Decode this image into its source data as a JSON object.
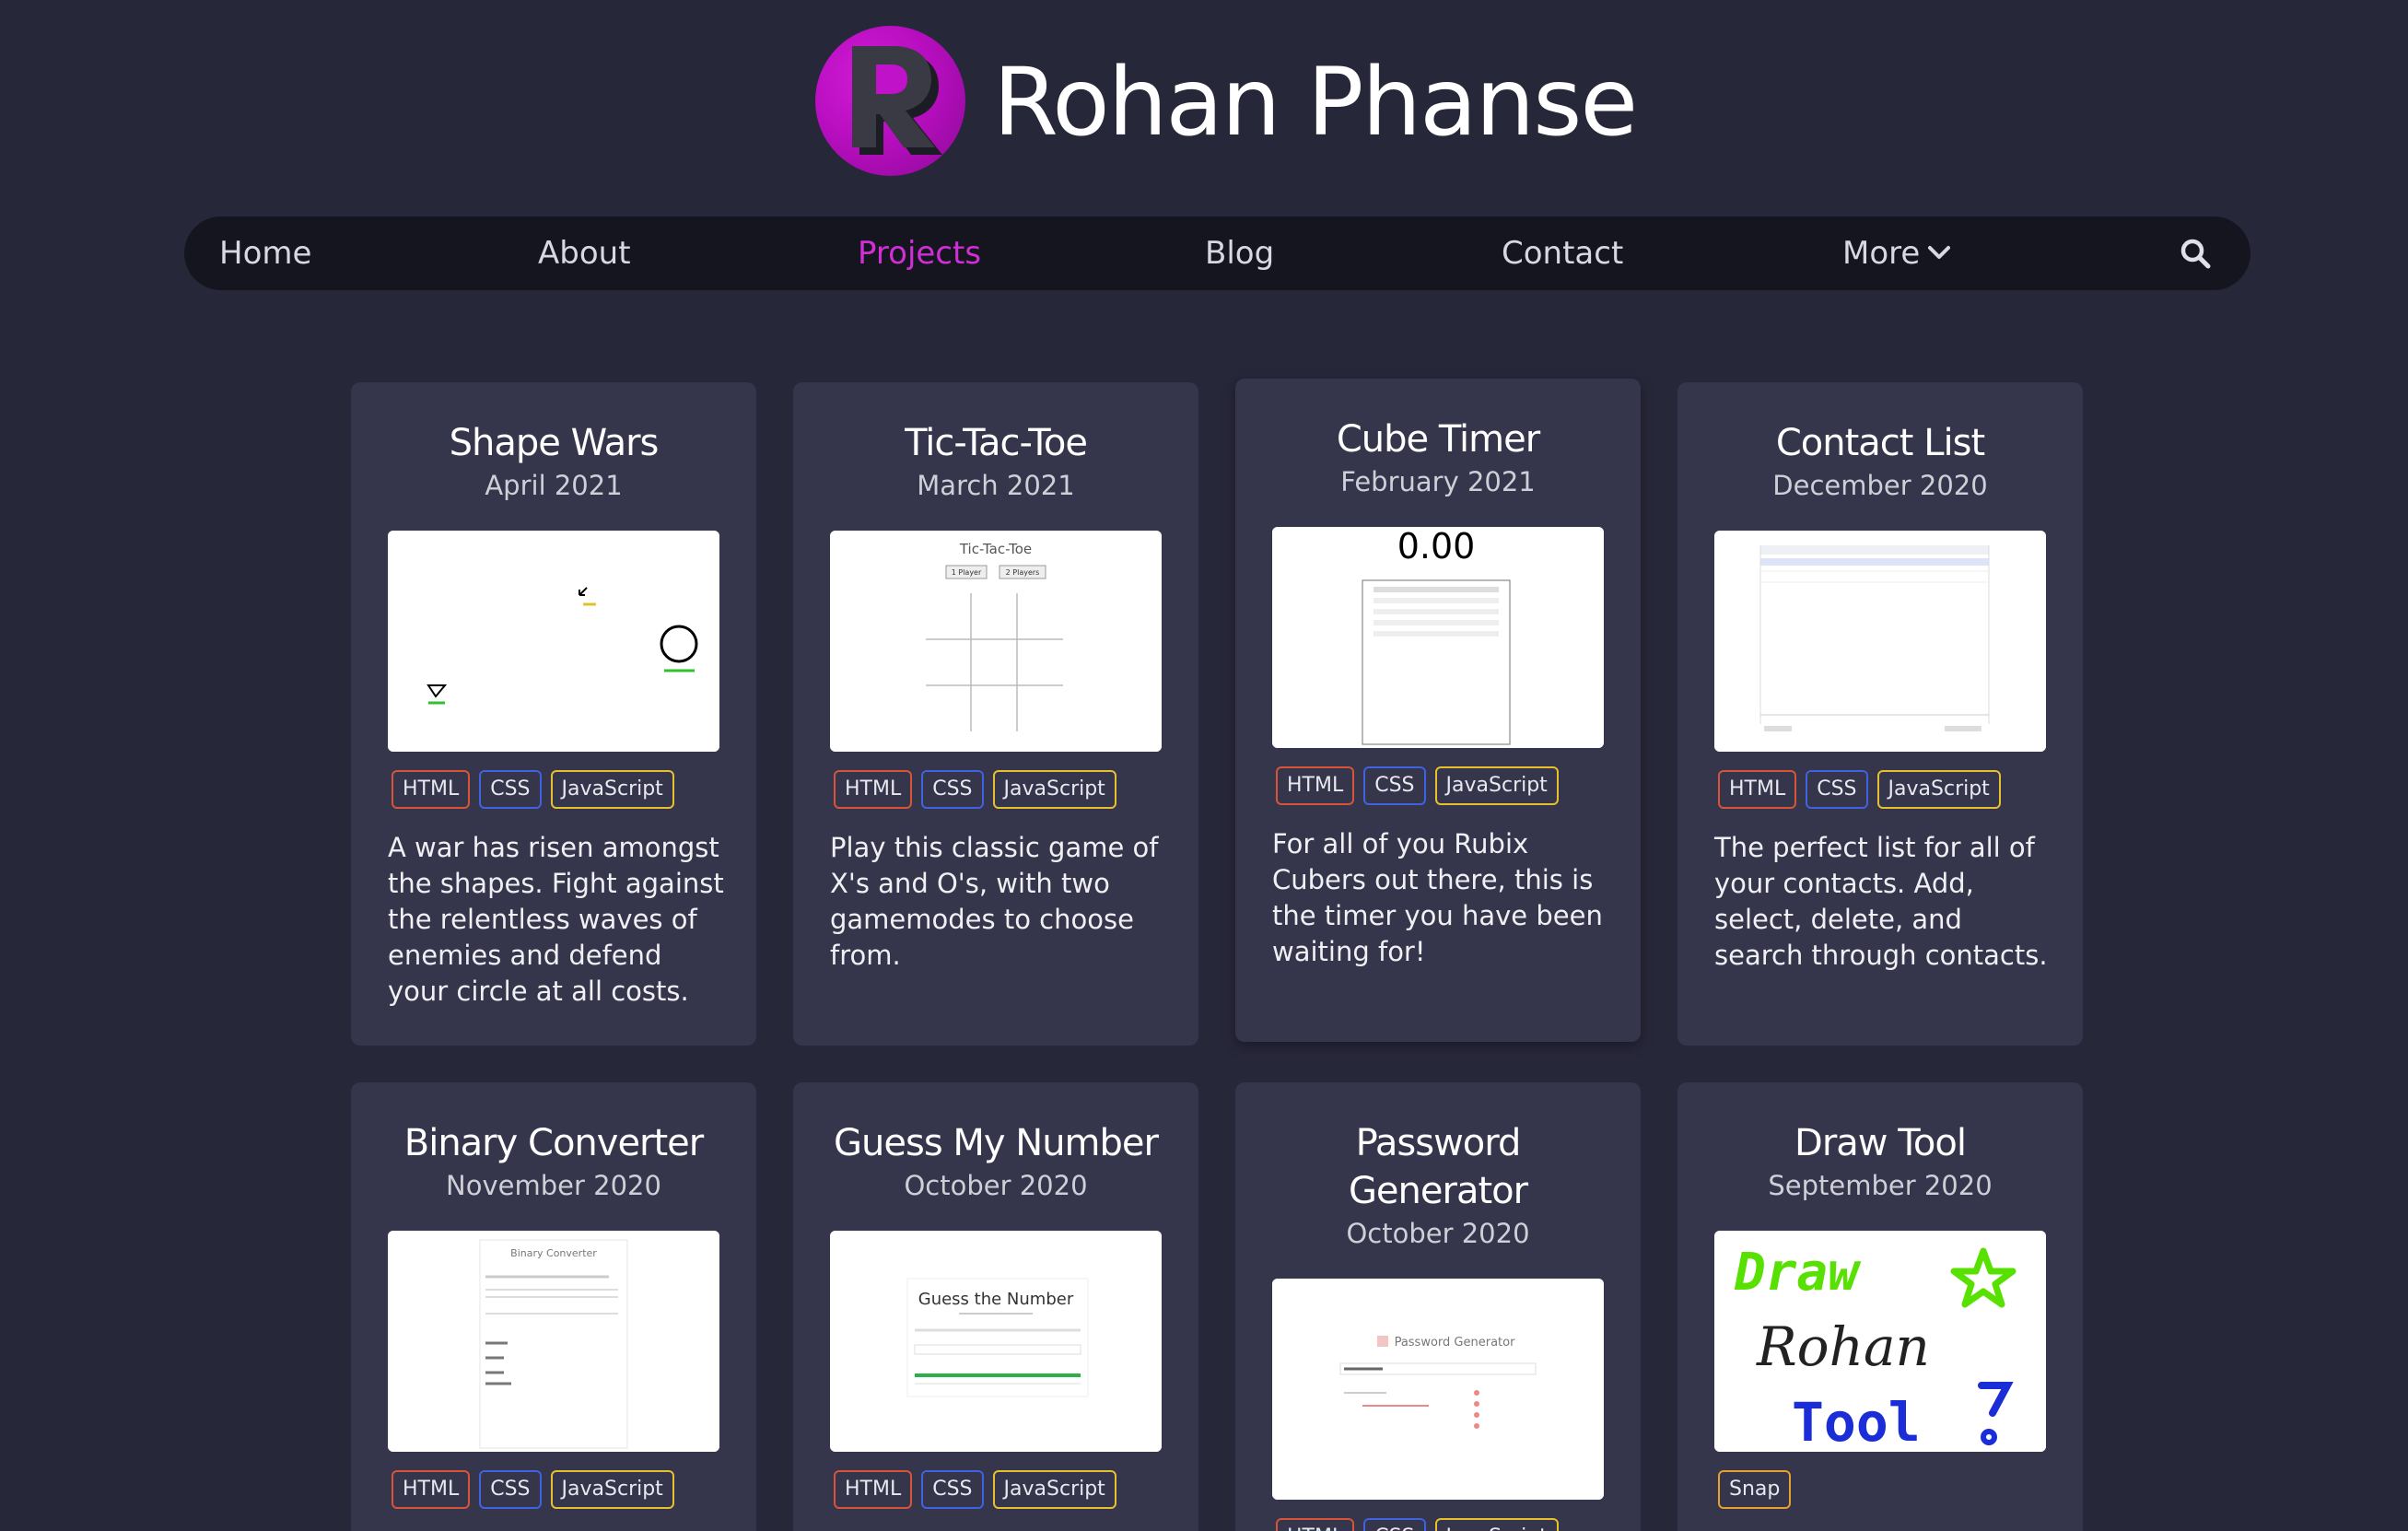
{
  "site": {
    "title": "Rohan Phanse",
    "logo_letter": "R"
  },
  "nav": {
    "items": [
      {
        "label": "Home"
      },
      {
        "label": "About"
      },
      {
        "label": "Projects"
      },
      {
        "label": "Blog"
      },
      {
        "label": "Contact"
      },
      {
        "label": "More"
      }
    ],
    "active": "Projects",
    "search_icon": "search-icon"
  },
  "colors": {
    "background": "#27273a",
    "card": "#35354b",
    "nav": "#151520",
    "accent": "#d12ed6",
    "tag_html": "#d9533b",
    "tag_css": "#3e62e0",
    "tag_js": "#e6c12d"
  },
  "projects": [
    {
      "title": "Shape Wars",
      "date": "April 2021",
      "tags": [
        "HTML",
        "CSS",
        "JavaScript"
      ],
      "description": "A war has risen amongst the shapes. Fight against the relentless waves of enemies and defend your circle at all costs."
    },
    {
      "title": "Tic-Tac-Toe",
      "date": "March 2021",
      "tags": [
        "HTML",
        "CSS",
        "JavaScript"
      ],
      "description": "Play this classic game of X's and O's, with two gamemodes to choose from.",
      "thumb": {
        "heading": "Tic-Tac-Toe",
        "btn1": "1 Player",
        "btn2": "2 Players"
      }
    },
    {
      "title": "Cube Timer",
      "date": "February 2021",
      "tags": [
        "HTML",
        "CSS",
        "JavaScript"
      ],
      "description": "For all of you Rubix Cubers out there, this is the timer you have been waiting for!",
      "thumb": {
        "time": "0.00"
      }
    },
    {
      "title": "Contact List",
      "date": "December 2020",
      "tags": [
        "HTML",
        "CSS",
        "JavaScript"
      ],
      "description": "The perfect list for all of your contacts. Add, select, delete, and search through contacts."
    },
    {
      "title": "Binary Converter",
      "date": "November 2020",
      "tags": [
        "HTML",
        "CSS",
        "JavaScript"
      ],
      "thumb": {
        "heading": "Binary Converter"
      }
    },
    {
      "title": "Guess My Number",
      "date": "October 2020",
      "tags": [
        "HTML",
        "CSS",
        "JavaScript"
      ],
      "thumb": {
        "heading": "Guess the Number"
      }
    },
    {
      "title": "Password Generator",
      "date": "October 2020",
      "tags": [
        "HTML",
        "CSS",
        "JavaScript"
      ],
      "thumb": {
        "heading": "Password Generator"
      }
    },
    {
      "title": "Draw Tool",
      "date": "September 2020",
      "tags": [
        "Snap"
      ],
      "thumb": {
        "word1": "Draw",
        "word2": "Rohan",
        "word3": "Tool"
      }
    }
  ]
}
